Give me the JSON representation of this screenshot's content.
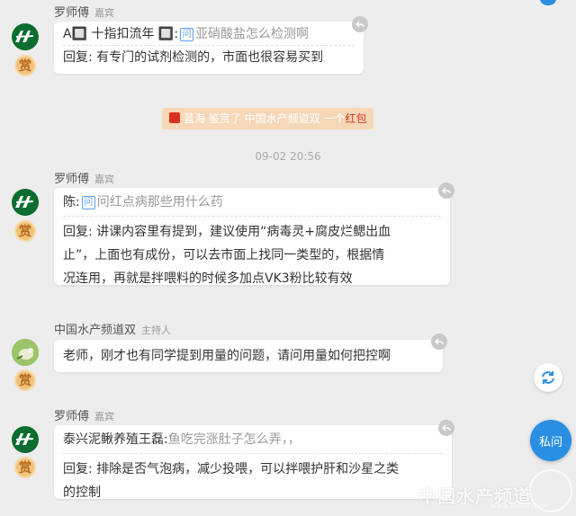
{
  "messages": [
    {
      "name": "罗师傅",
      "role": "嘉宾",
      "question_asker": "A🔲 十指扣流年 🔲:",
      "question_badge": "问",
      "question_text": "亚硝酸盐怎么检测啊",
      "answer": "回复: 有专门的试剂检测的，市面也很容易买到",
      "reward_label": "赏"
    },
    {
      "name": "罗师傅",
      "role": "嘉宾",
      "question_asker": "陈:",
      "question_badge": "问",
      "question_text": "问红点病那些用什么药",
      "answer_lines": [
        "回复: 讲课内容里有提到，建议使用“病毒灵+腐皮烂鳃出血",
        "止”，上面也有成份，可以去市面上找同一类型的，根据情",
        "况连用，再就是拌喂料的时候多加点VK3粉比较有效"
      ],
      "reward_label": "赏"
    },
    {
      "name": "中国水产频道双",
      "role": "主持人",
      "text": "老师，刚才也有同学提到用量的问题，请问用量如何把控啊",
      "reward_label": "赏"
    },
    {
      "name": "罗师傅",
      "role": "嘉宾",
      "question_asker": "泰兴泥鳅养殖王磊:",
      "question_text": "鱼吃完涨肚子怎么弄，，",
      "answer_lines": [
        "回复: 排除是否气泡病，减少投喂，可以拌喂护肝和沙星之类",
        "的控制"
      ],
      "reward_label": "赏"
    }
  ],
  "banner": {
    "sender": "蓝海",
    "middle": " 鉴赏了 中国水产频道双 一个",
    "gift": "红包"
  },
  "timestamp": "09-02 20:56",
  "ask_button_label": "私问",
  "watermark": {
    "text": "中国水产频道",
    "url": "www.fishfirst.cn"
  },
  "colors": {
    "accent": "#2a8fe3",
    "reward": "#f1c27a",
    "banner_bg": "#f6d7b7",
    "gift_red": "#d9331f"
  }
}
